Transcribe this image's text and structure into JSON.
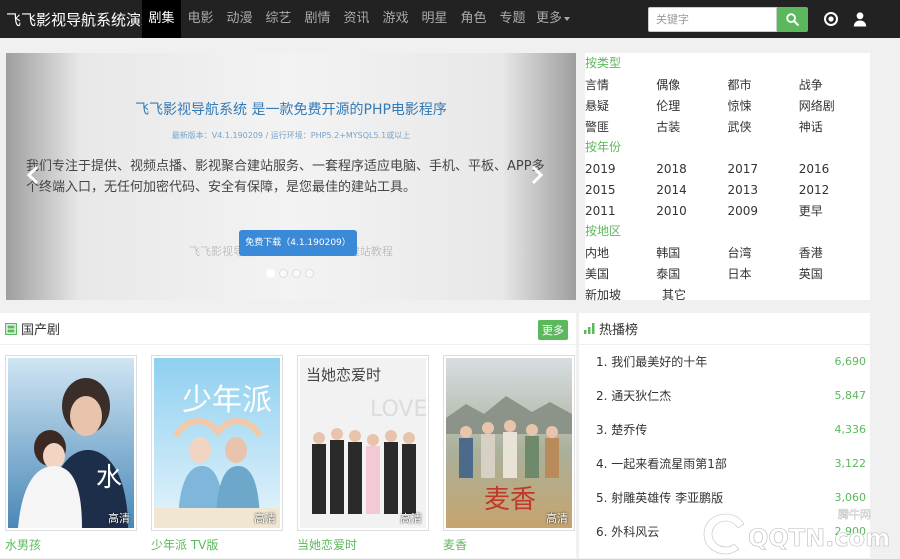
{
  "header": {
    "logo": "飞飞影视导航系统演示",
    "nav": [
      "剧集",
      "电影",
      "动漫",
      "综艺",
      "剧情",
      "资讯",
      "游戏",
      "明星",
      "角色",
      "专题"
    ],
    "more": "更多",
    "search_placeholder": "关键字"
  },
  "banner": {
    "title": "飞飞影视导航系统 是一款免费开源的PHP电影程序",
    "version": "最新版本：V4.1.190209 / 运行环境：PHP5.2+MYSQL5.1或以上",
    "desc": "我们专注于提供、视频点播、影视聚合建站服务、一套程序适应电脑、手机、平板、APP多个终端入口，无任何加密代码、安全有保障，是您最佳的建站工具。",
    "button": "免费下载（4.1.190209）",
    "subtitle": "飞飞影视导航系统（feifeicms）建站教程"
  },
  "filters": [
    {
      "title": "按类型",
      "rows": [
        [
          "言情",
          "偶像",
          "都市",
          "战争"
        ],
        [
          "悬疑",
          "伦理",
          "惊悚",
          "网络剧"
        ],
        [
          "警匪",
          "古装",
          "武侠",
          "神话"
        ]
      ]
    },
    {
      "title": "按年份",
      "rows": [
        [
          "2019",
          "2018",
          "2017",
          "2016"
        ],
        [
          "2015",
          "2014",
          "2013",
          "2012"
        ],
        [
          "2011",
          "2010",
          "2009",
          "更早"
        ]
      ]
    },
    {
      "title": "按地区",
      "rows": [
        [
          "内地",
          "韩国",
          "台湾",
          "香港"
        ],
        [
          "美国",
          "泰国",
          "日本",
          "英国"
        ],
        [
          "新加坡",
          "其它"
        ]
      ]
    }
  ],
  "section": {
    "title": "国产剧",
    "more": "更多",
    "items": [
      {
        "name": "水男孩",
        "tag": "高清"
      },
      {
        "name": "少年派 TV版",
        "tag": "高清"
      },
      {
        "name": "当她恋爱时",
        "tag": "高清"
      },
      {
        "name": "麦香",
        "tag": "高清"
      }
    ]
  },
  "hot": {
    "title": "热播榜",
    "items": [
      {
        "name": "1. 我们最美好的十年",
        "hits": "6,690"
      },
      {
        "name": "2. 通天狄仁杰",
        "hits": "5,847"
      },
      {
        "name": "3. 楚乔传",
        "hits": "4,336"
      },
      {
        "name": "4. 一起来看流星雨第1部",
        "hits": "3,122"
      },
      {
        "name": "5. 射雕英雄传 李亚鹏版",
        "hits": "3,060"
      },
      {
        "name": "6. 外科风云",
        "hits": "2,900"
      }
    ]
  },
  "watermark": {
    "cn": "腾牛网",
    "en": "QQTN.com"
  },
  "colors": {
    "accent": "#5cb85c",
    "topbar": "#222222",
    "link": "#337ab7"
  }
}
